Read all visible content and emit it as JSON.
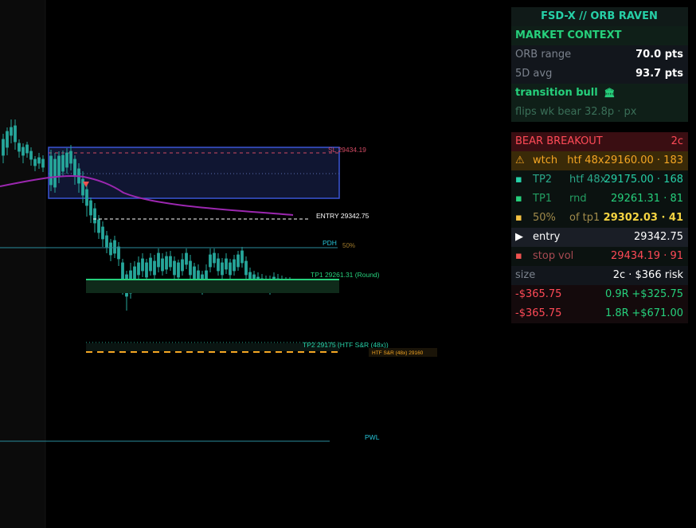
{
  "chart": {
    "sl_label": "SL 29434.19",
    "entry_label": "ENTRY 29342.75",
    "pdh_label": "PDH",
    "fifty_label": "50%",
    "tp1_label": "TP1 29261.31 (Round)",
    "tp2_label": "TP2 29175 (HTF S&R (48x))",
    "htf_label": "HTF S&R (48x) 29160",
    "pwl_label": "PWL"
  },
  "panel": {
    "title": "FSD-X // ORB RAVEN",
    "market_context": "MARKET CONTEXT",
    "orb_range_label": "ORB range",
    "orb_range_value": "70.0 pts",
    "avg_label": "5D avg",
    "avg_value": "93.7 pts",
    "regime": "transition bull",
    "flips": "flips wk bear 32.8p · px",
    "bear_title": "BEAR BREAKOUT",
    "bear_contracts": "2c",
    "watch": {
      "icon": "warning-icon",
      "label": "wtch",
      "src": "htf 48x",
      "value": "29160.00 · 183"
    },
    "tp2": {
      "label": "TP2",
      "src": "htf 48x",
      "value": "29175.00 · 168"
    },
    "tp1": {
      "label": "TP1",
      "src": "rnd",
      "value": "29261.31 · 81"
    },
    "half": {
      "label": "50%",
      "src": "of tp1",
      "value": "29302.03 · 41"
    },
    "entry": {
      "label": "entry",
      "value": "29342.75"
    },
    "stop": {
      "label": "stop",
      "src": "vol",
      "value": "29434.19 · 91"
    },
    "size_label": "size",
    "size_value": "2c · $366 risk",
    "pnl": [
      {
        "risk": "-$365.75",
        "r": "0.9R",
        "reward": "+$325.75"
      },
      {
        "risk": "-$365.75",
        "r": "1.8R",
        "reward": "+$671.00"
      }
    ]
  },
  "colors": {
    "bull": "#26a69a",
    "bear": "#ef5350",
    "accent": "#26d0a7",
    "warning": "#f5a623",
    "vwap": "#9c27b0"
  }
}
